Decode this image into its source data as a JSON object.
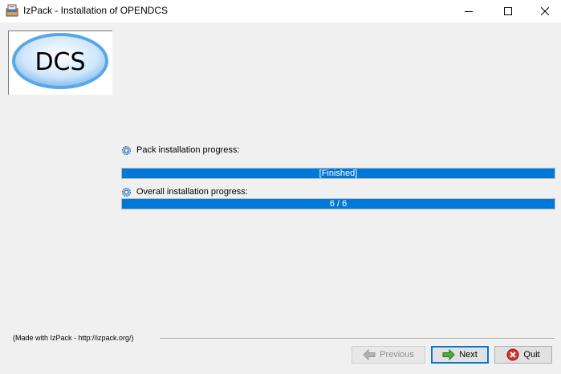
{
  "window": {
    "title": "IzPack - Installation of OPENDCS",
    "minimize_icon": "minimize-icon",
    "maximize_icon": "maximize-icon",
    "close_icon": "close-icon"
  },
  "logo": {
    "text": "DCS"
  },
  "progress": {
    "pack_label": "Pack installation progress:",
    "pack_value_text": "[Finished]",
    "pack_fraction": 1.0,
    "overall_label": "Overall installation progress:",
    "overall_value_text": "6 / 6",
    "overall_fraction": 1.0
  },
  "footer": {
    "credit": "(Made with IzPack - http://izpack.org/)",
    "previous_label": "Previous",
    "next_label": "Next",
    "quit_label": "Quit"
  },
  "colors": {
    "progress_fill": "#0078d7",
    "window_background": "#f0f0f0"
  }
}
